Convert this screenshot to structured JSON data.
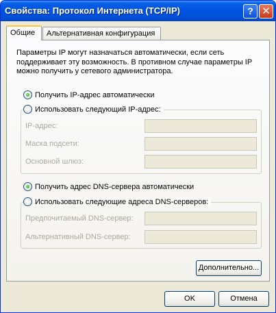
{
  "window": {
    "title": "Свойства: Протокол Интернета (TCP/IP)",
    "help_glyph": "?",
    "close_glyph": "✕"
  },
  "tabs": [
    {
      "label": "Общие"
    },
    {
      "label": "Альтернативная конфигурация"
    }
  ],
  "description": "Параметры IP могут назначаться автоматически, если сеть поддерживает эту возможность. В противном случае параметры IP можно получить у сетевого администратора.",
  "ip": {
    "auto_label": "Получить IP-адрес автоматически",
    "manual_label": "Использовать следующий IP-адрес:",
    "auto_selected": true,
    "fields": [
      {
        "label": "IP-адрес:",
        "value": ""
      },
      {
        "label": "Маска подсети:",
        "value": ""
      },
      {
        "label": "Основной шлюз:",
        "value": ""
      }
    ]
  },
  "dns": {
    "auto_label": "Получить адрес DNS-сервера автоматически",
    "manual_label": "Использовать следующие адреса DNS-серверов:",
    "auto_selected": true,
    "fields": [
      {
        "label": "Предпочитаемый DNS-сервер:",
        "value": ""
      },
      {
        "label": "Альтернативный DNS-сервер:",
        "value": ""
      }
    ]
  },
  "buttons": {
    "advanced": "Дополнительно...",
    "ok": "OK",
    "cancel": "Отмена"
  }
}
